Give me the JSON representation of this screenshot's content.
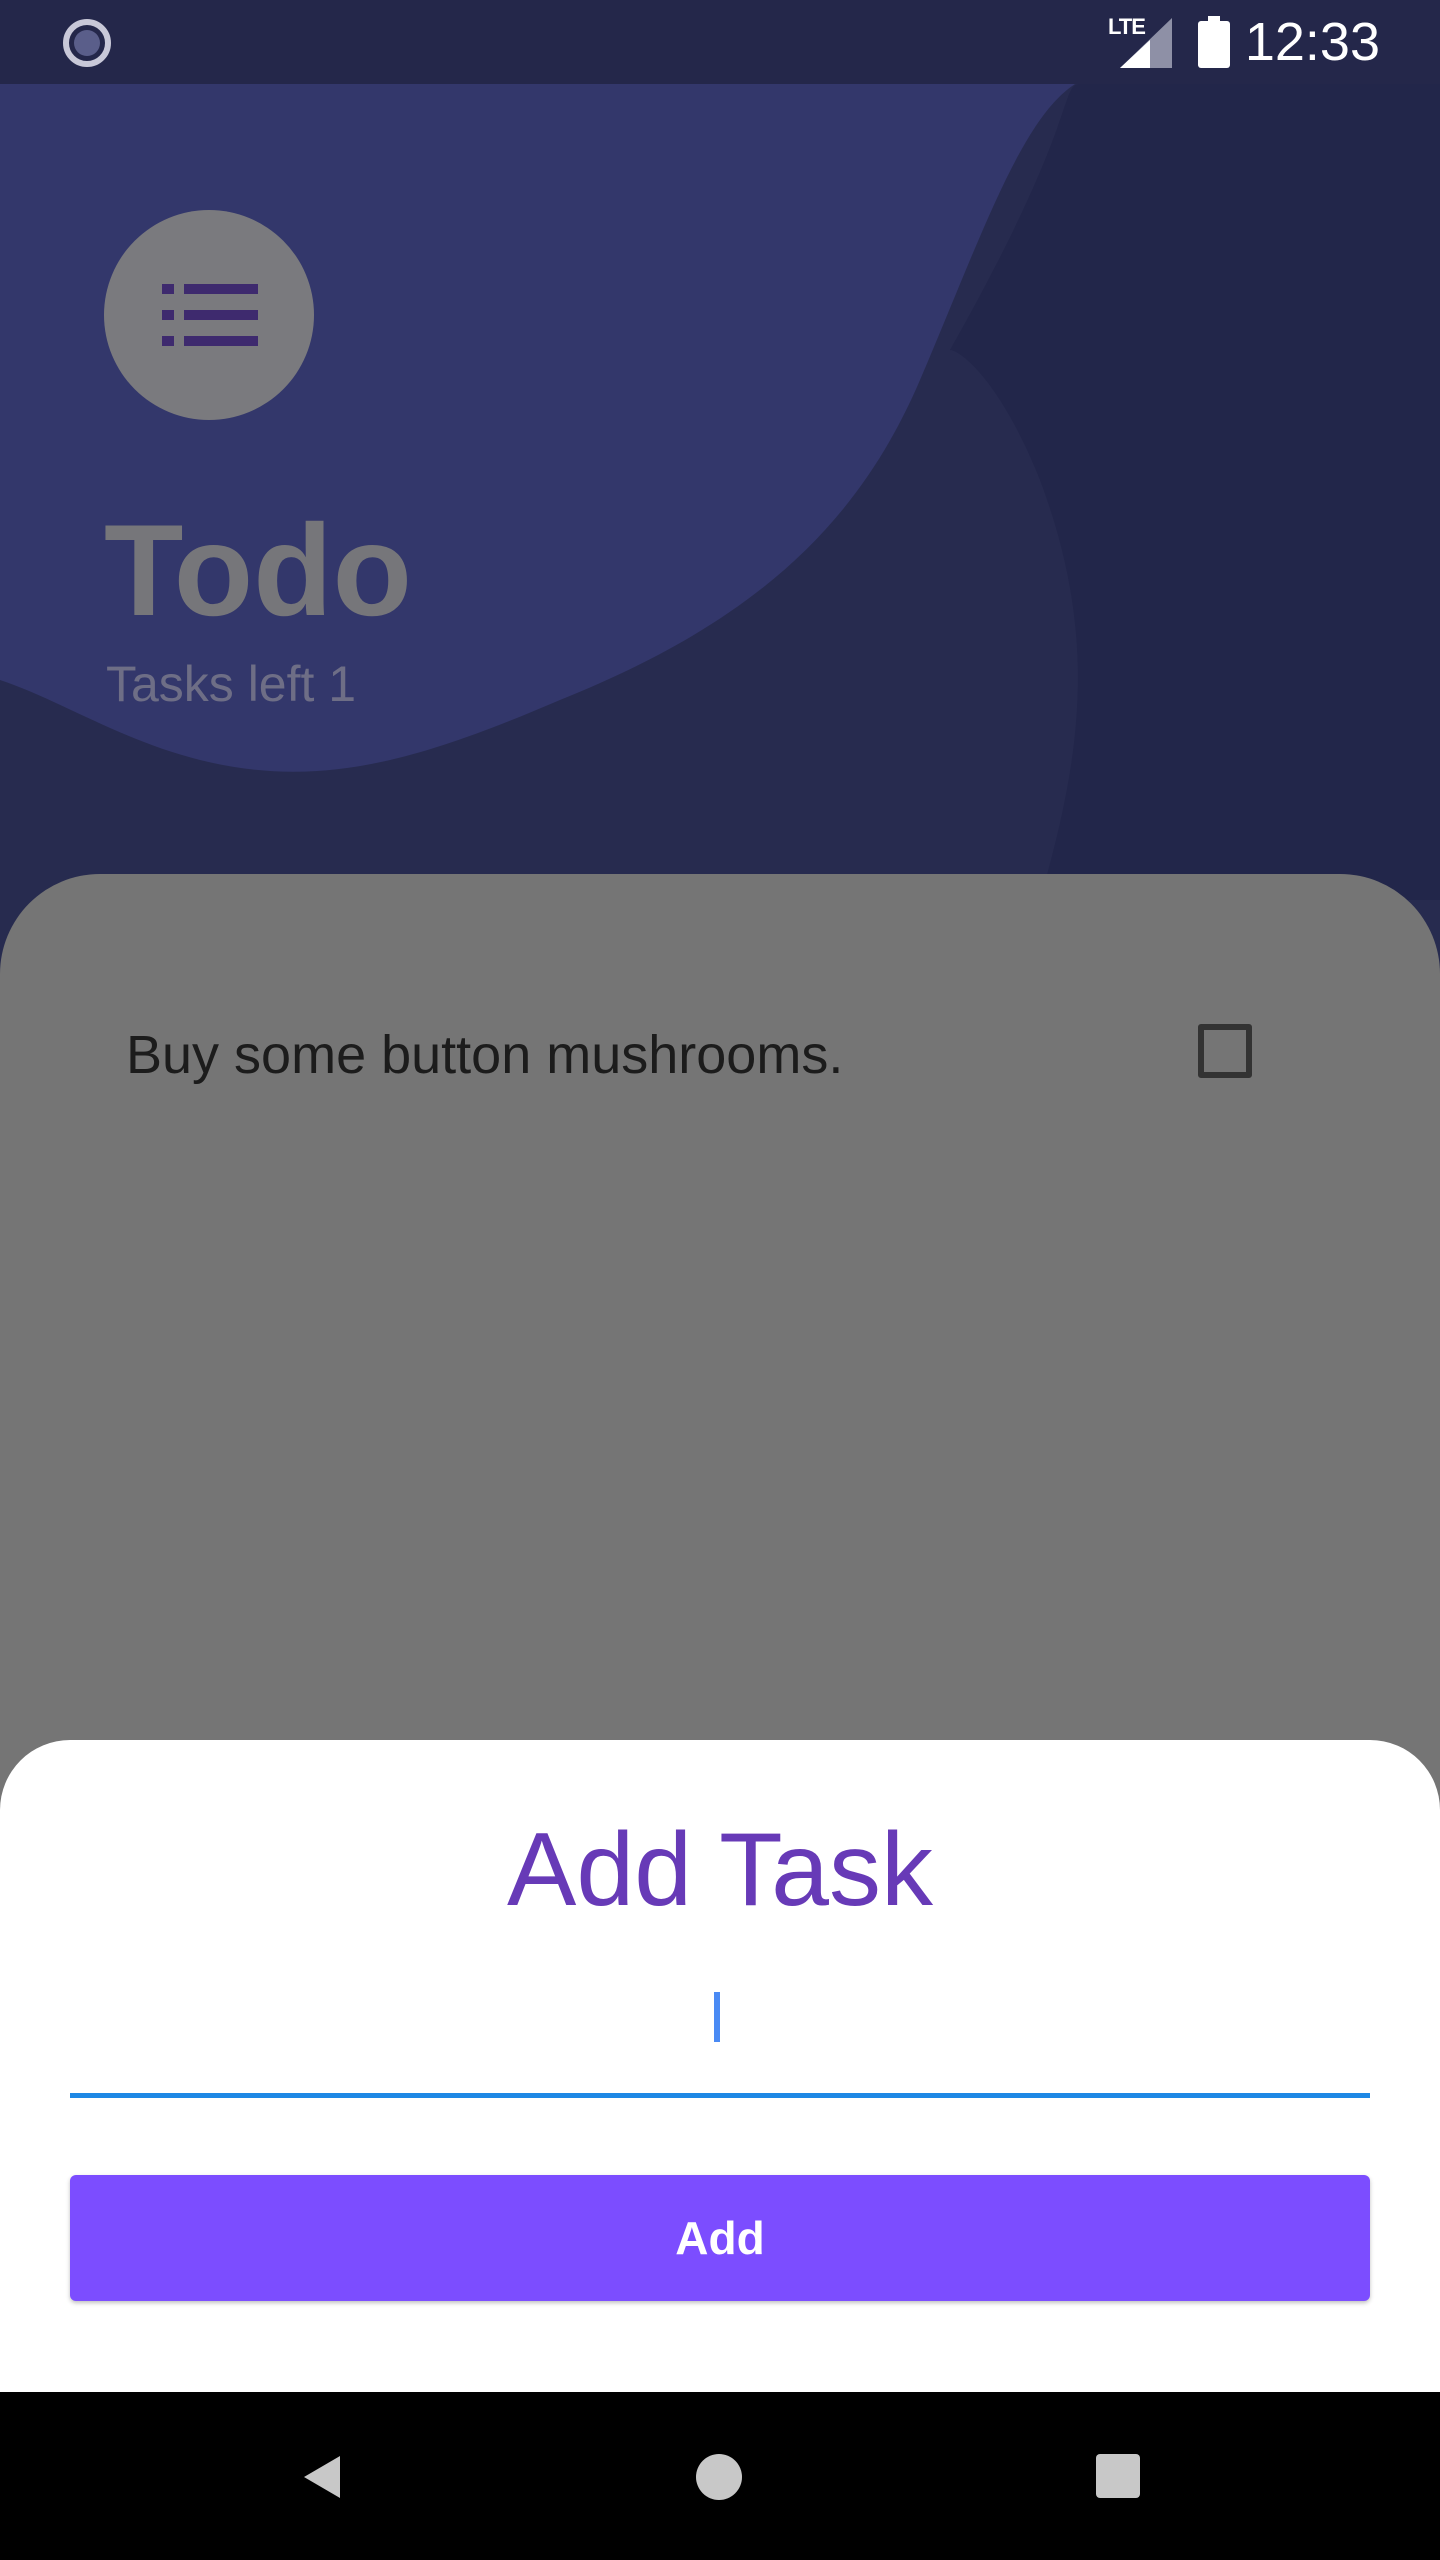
{
  "status_bar": {
    "network_label": "LTE",
    "time": "12:33",
    "icons": [
      "spinner-icon",
      "lte-icon",
      "signal-icon",
      "battery-icon"
    ]
  },
  "header": {
    "logo_icon": "list-icon",
    "title": "Todo",
    "subtitle": "Tasks left 1"
  },
  "tasks": [
    {
      "label": "Buy some button mushrooms.",
      "checked": false
    }
  ],
  "add_sheet": {
    "title": "Add Task",
    "input_value": "",
    "input_placeholder": "",
    "add_button_label": "Add"
  },
  "nav_bar": {
    "icons": [
      "back-icon",
      "home-icon",
      "recents-icon"
    ]
  },
  "colors": {
    "background": "#272B4F",
    "accent_purple": "#7C4DFF",
    "title_purple": "#673AB7",
    "input_underline": "#1E88E5"
  }
}
